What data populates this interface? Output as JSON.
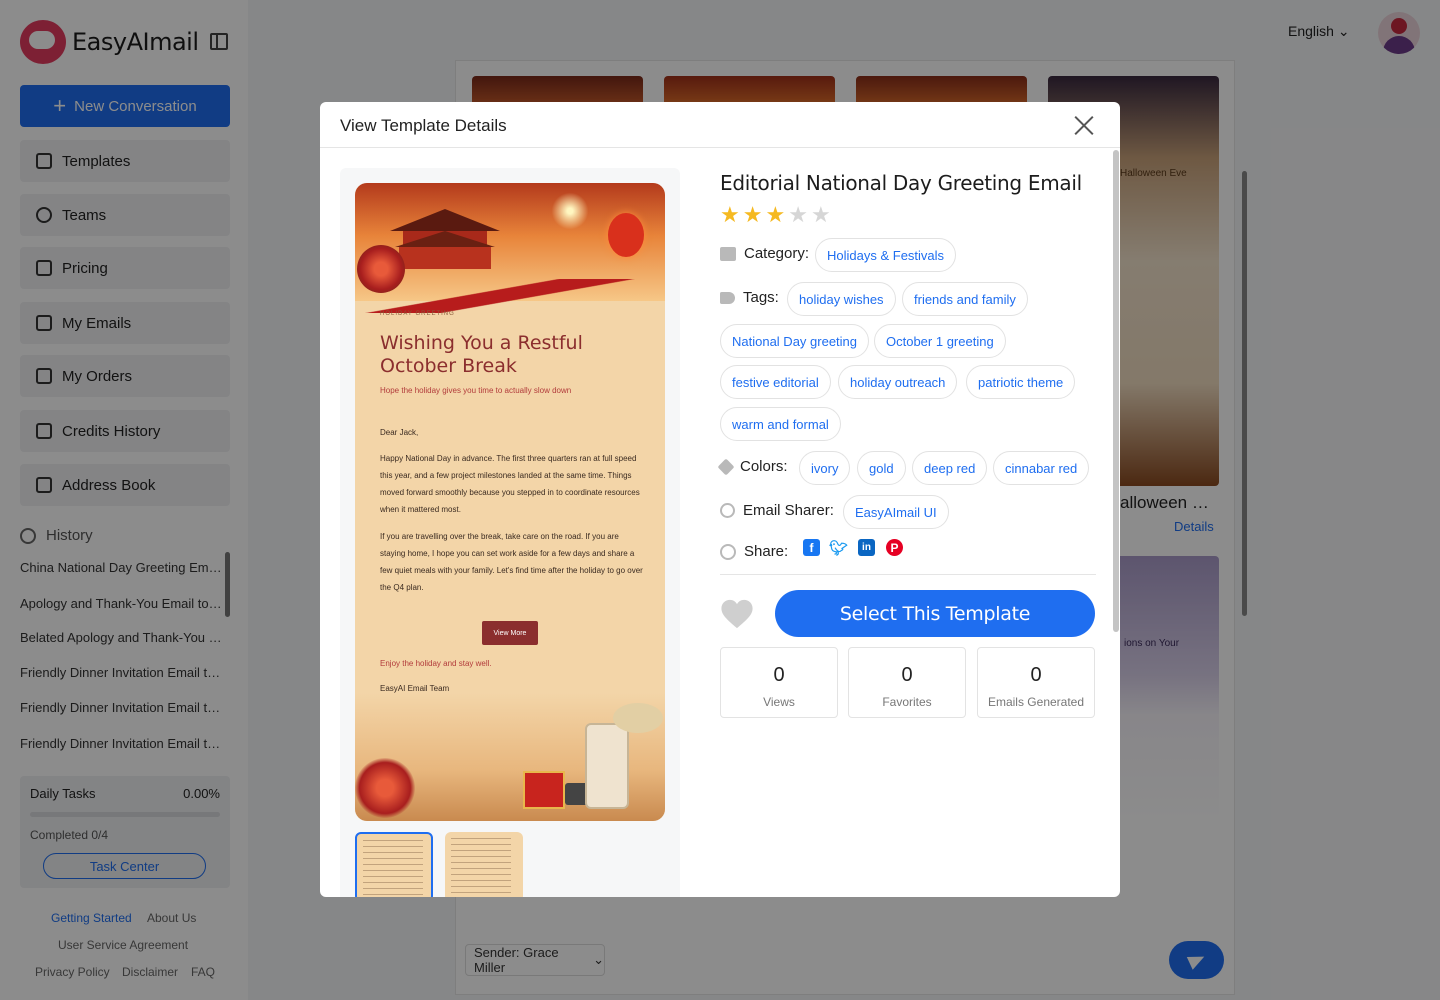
{
  "app": {
    "name": "EasyAImail",
    "new_conversation": "New Conversation",
    "language": "English",
    "nav": [
      {
        "label": "Templates",
        "icon": "grid-icon"
      },
      {
        "label": "Teams",
        "icon": "team-icon"
      },
      {
        "label": "Pricing",
        "icon": "box-icon"
      },
      {
        "label": "My Emails",
        "icon": "mail-icon"
      },
      {
        "label": "My Orders",
        "icon": "clipboard-icon"
      },
      {
        "label": "Credits History",
        "icon": "database-icon"
      },
      {
        "label": "Address Book",
        "icon": "contact-book-icon"
      }
    ],
    "history_title": "History",
    "history": [
      "China National Day Greeting Em…",
      "Apology and Thank-You Email to …",
      "Belated Apology and Thank-You …",
      "Friendly Dinner Invitation Email t…",
      "Friendly Dinner Invitation Email t…",
      "Friendly Dinner Invitation Email t…"
    ],
    "tasks": {
      "title": "Daily Tasks",
      "percent": "0.00%",
      "completed": "Completed 0/4",
      "button": "Task Center"
    },
    "footer": [
      "Getting Started",
      "About Us",
      "User Service Agreement",
      "Privacy Policy",
      "Disclaimer",
      "FAQ"
    ],
    "sender": "Sender: Grace Miller",
    "bg_cards": {
      "halloween_title": "alloween …",
      "details": "Details",
      "halloween_eve": "Halloween Eve",
      "ions_on_your": "ions on Your"
    }
  },
  "modal": {
    "title": "View Template Details",
    "template_title": "Editorial National Day Greeting Email",
    "rating": 3,
    "rating_max": 5,
    "category_label": "Category:",
    "category": "Holidays & Festivals",
    "tags_label": "Tags:",
    "tags": [
      "holiday wishes",
      "friends and family",
      "National Day greeting",
      "October 1 greeting",
      "festive editorial",
      "holiday outreach",
      "patriotic theme",
      "warm and formal"
    ],
    "colors_label": "Colors:",
    "colors": [
      "ivory",
      "gold",
      "deep red",
      "cinnabar red"
    ],
    "sharer_label": "Email Sharer:",
    "sharer": "EasyAImail UI",
    "share_label": "Share:",
    "select_button": "Select This Template",
    "stats": [
      {
        "value": "0",
        "label": "Views"
      },
      {
        "value": "0",
        "label": "Favorites"
      },
      {
        "value": "0",
        "label": "Emails Generated"
      }
    ],
    "preview": {
      "label": "HOLIDAY GREETING",
      "heading": "Wishing You a Restful October Break",
      "subheading": "Hope the holiday gives you time to actually slow down",
      "greeting": "Dear Jack,",
      "p1": "Happy National Day in advance. The first three quarters ran at full speed this year, and a few project milestones landed at the same time. Things moved forward smoothly because you stepped in to coordinate resources when it mattered most.",
      "p2": "If you are travelling over the break, take care on the road. If you are staying home, I hope you can set work aside for a few days and share a few quiet meals with your family. Let's find time after the holiday to go over the Q4 plan.",
      "button": "View More",
      "closing": "Enjoy the holiday and stay well.",
      "signature": "EasyAI Email Team"
    }
  },
  "colors": {
    "accent": "#1f6ef0",
    "star": "#f5b921",
    "brand_red": "#e43b5f"
  }
}
